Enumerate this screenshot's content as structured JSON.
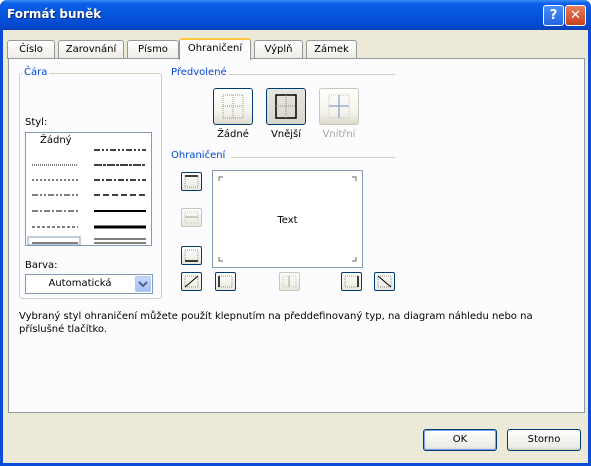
{
  "window": {
    "title": "Formát buněk",
    "help": "?",
    "close": "✕"
  },
  "tabs": [
    {
      "label": "Číslo"
    },
    {
      "label": "Zarovnání"
    },
    {
      "label": "Písmo"
    },
    {
      "label": "Ohraničení",
      "active": true
    },
    {
      "label": "Výplň"
    },
    {
      "label": "Zámek"
    }
  ],
  "line_group": {
    "legend": "Čára",
    "style_label": "Styl:",
    "none_label": "Žádný",
    "color_label": "Barva:",
    "color_value": "Automatická"
  },
  "presets": {
    "legend": "Předvolené",
    "none": "Žádné",
    "outline": "Vnější",
    "inside": "Vnitřní"
  },
  "border": {
    "legend": "Ohraničení",
    "preview_text": "Text"
  },
  "description": "Vybraný styl ohraničení můžete použít klepnutím na předdefinovaný typ, na diagram náhledu nebo na příslušné tlačítko.",
  "buttons": {
    "ok": "OK",
    "cancel": "Storno"
  },
  "colors": {
    "accent": "#0046d5",
    "titlebar": "#0654dc",
    "face": "#ece9d8"
  }
}
